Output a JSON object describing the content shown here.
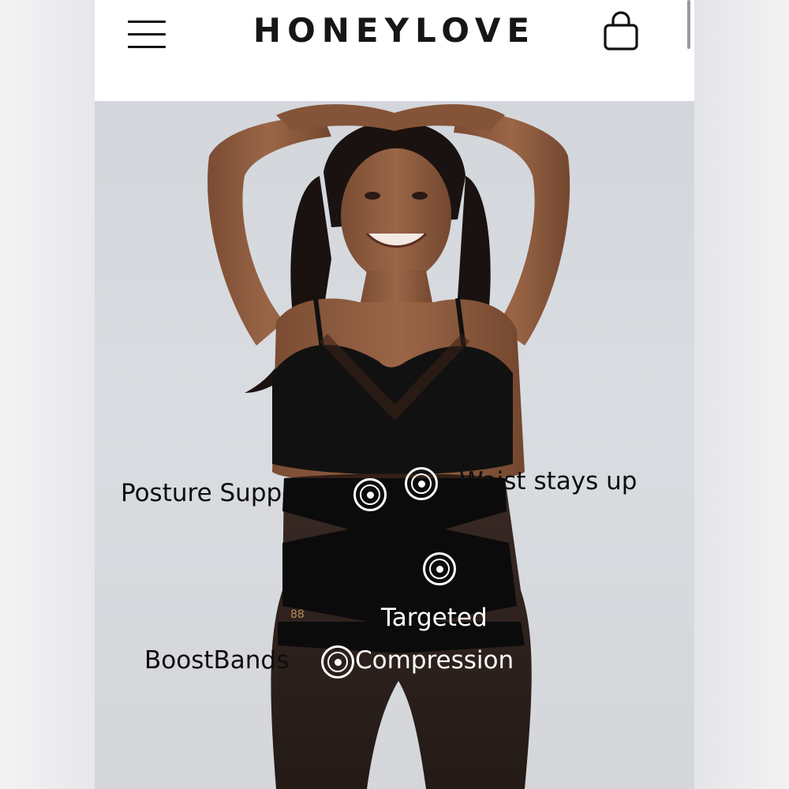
{
  "header": {
    "brand": "HONEYLOVE",
    "menu_icon": "hamburger-menu-icon",
    "cart_icon": "shopping-bag-icon"
  },
  "colors": {
    "header_bg": "#ffffff",
    "brand_text": "#161616",
    "backdrop": "#d6d9dd",
    "garment": "#111111",
    "skin": "#8a5a3e",
    "hotspot": "#ffffff"
  },
  "hero": {
    "image_subject": "model wearing black shapewear",
    "hotspots": [
      {
        "label": "Posture Support"
      },
      {
        "label": "Waist stays up"
      },
      {
        "label": "Targeted"
      },
      {
        "label": "Compression"
      },
      {
        "label": "BoostBands"
      }
    ]
  }
}
